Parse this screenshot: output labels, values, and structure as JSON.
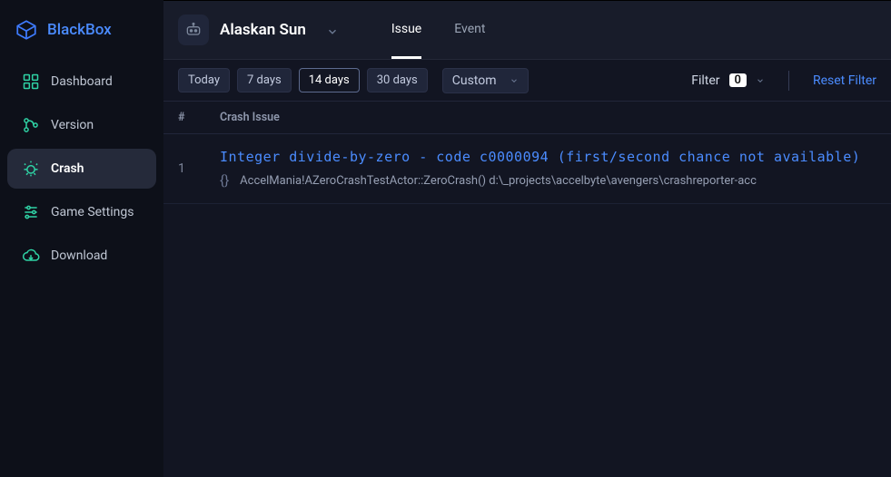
{
  "brand": {
    "name": "BlackBox"
  },
  "sidebar": {
    "items": [
      {
        "label": "Dashboard"
      },
      {
        "label": "Version"
      },
      {
        "label": "Crash"
      },
      {
        "label": "Game Settings"
      },
      {
        "label": "Download"
      }
    ]
  },
  "project": {
    "name": "Alaskan Sun"
  },
  "tabs": [
    {
      "label": "Issue"
    },
    {
      "label": "Event"
    }
  ],
  "filters": {
    "ranges": [
      {
        "label": "Today"
      },
      {
        "label": "7 days"
      },
      {
        "label": "14 days"
      },
      {
        "label": "30 days"
      }
    ],
    "custom_label": "Custom",
    "filter_label": "Filter",
    "filter_count": "0",
    "reset_label": "Reset Filter"
  },
  "table": {
    "col_num": "#",
    "col_issue": "Crash Issue",
    "rows": [
      {
        "num": "1",
        "title": "Integer divide-by-zero - code c0000094 (first/second chance not available)",
        "subtitle": "AccelMania!AZeroCrashTestActor::ZeroCrash() d:\\_projects\\accelbyte\\avengers\\crashreporter-acc"
      }
    ]
  }
}
